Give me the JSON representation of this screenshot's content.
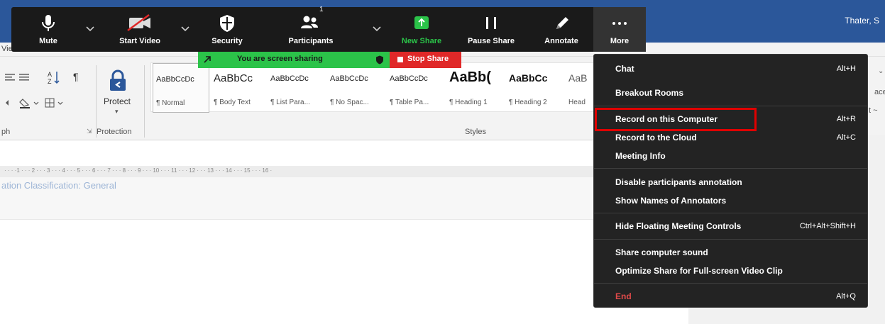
{
  "word": {
    "user_name": "Thater, S",
    "tab_fragment": "Vie",
    "protect_label": "Protect",
    "group_labels": {
      "protection": "Protection",
      "styles": "Styles",
      "paragraph_fragment": "ph"
    },
    "styles": [
      {
        "sample": "AaBbCcDc",
        "name": "¶ Normal"
      },
      {
        "sample": "AaBbCc",
        "name": "¶ Body Text"
      },
      {
        "sample": "AaBbCcDc",
        "name": "¶ List Para..."
      },
      {
        "sample": "AaBbCcDc",
        "name": "¶ No Spac..."
      },
      {
        "sample": "AaBbCcDc",
        "name": "¶ Table Pa..."
      },
      {
        "sample": "AaBb(",
        "name": "¶ Heading 1"
      },
      {
        "sample": "AaBbCc",
        "name": "¶ Heading 2"
      },
      {
        "sample": "AaB",
        "name": "Head"
      }
    ],
    "right_fragments": {
      "place": "ace",
      "select": "t ~",
      "ing": "g",
      "aab": "AaB"
    },
    "ruler_text": "· · · ·1 · · · 2 · · · 3 · · · 4 · · · 5 · · · 6 · · · 7 · · · 8 · · · 9 · · · 10 · · · 11 · · · 12 · · · 13 · · · 14 · · · 15 · · · 16 ·",
    "classification_text": "ation Classification: General"
  },
  "zoom": {
    "toolbar": {
      "mute": "Mute",
      "start_video": "Start Video",
      "security": "Security",
      "participants": "Participants",
      "participant_count": "1",
      "new_share": "New Share",
      "pause_share": "Pause Share",
      "annotate": "Annotate",
      "more": "More"
    },
    "share_banner": "You are screen sharing",
    "stop_share": "Stop Share",
    "accent_green": "#2bc349",
    "stop_red": "#e02828",
    "highlight_red": "#e00000",
    "more_menu": {
      "items": [
        {
          "label": "Chat",
          "shortcut": "Alt+H"
        },
        {
          "label": "Breakout Rooms",
          "shortcut": ""
        },
        {
          "label": "Record on this Computer",
          "shortcut": "Alt+R",
          "highlighted": true
        },
        {
          "label": "Record to the Cloud",
          "shortcut": "Alt+C"
        },
        {
          "label": "Meeting Info",
          "shortcut": ""
        },
        {
          "label": "Disable participants annotation",
          "shortcut": ""
        },
        {
          "label": "Show Names of Annotators",
          "shortcut": ""
        },
        {
          "label": "Hide Floating Meeting Controls",
          "shortcut": "Ctrl+Alt+Shift+H"
        },
        {
          "label": "Share computer sound",
          "shortcut": ""
        },
        {
          "label": "Optimize Share for Full-screen Video Clip",
          "shortcut": ""
        },
        {
          "label": "End",
          "shortcut": "Alt+Q"
        }
      ]
    }
  }
}
